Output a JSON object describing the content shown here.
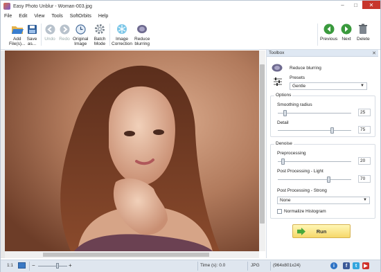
{
  "window": {
    "title": "Easy Photo Unblur - Woman-003.jpg"
  },
  "menu": [
    "File",
    "Edit",
    "View",
    "Tools",
    "SoftOrbits",
    "Help"
  ],
  "toolbar": {
    "add_files": "Add\nFile(s)...",
    "save_as": "Save\nas...",
    "undo": "Undo",
    "redo": "Redo",
    "original_image": "Original\nImage",
    "batch_mode": "Batch\nMode",
    "image_correction": "Image\nCorrection",
    "reduce_blurring": "Reduce\nblurring",
    "previous": "Previous",
    "next": "Next",
    "delete": "Delete"
  },
  "toolbox": {
    "title": "Toolbox",
    "tool_name": "Reduce blurring",
    "presets_label": "Presets",
    "preset_value": "Gentle",
    "options": {
      "title": "Options",
      "smoothing_label": "Smoothing radius",
      "smoothing_value": "25",
      "smoothing_level": 0.08,
      "detail_label": "Detail",
      "detail_value": "75",
      "detail_level": 0.75
    },
    "denoise": {
      "title": "Denoise",
      "pre_label": "Preprocessing",
      "pre_value": "20",
      "pre_level": 0.05,
      "post_light_label": "Post Processing - Light",
      "post_light_value": "70",
      "post_light_level": 0.7,
      "post_strong_label": "Post Processing - Strong",
      "post_strong_value": "None",
      "normalize_label": "Normalize Histogram",
      "normalize_checked": false
    },
    "run_label": "Run"
  },
  "status": {
    "zoom_ratio": "1:1",
    "time": "Time (s): 0.0",
    "format": "JPG",
    "dimensions": "(964x801x24)"
  },
  "colors": {
    "accent": "#dfe6ef",
    "close": "#c7362c",
    "run": "#f6d86a"
  }
}
